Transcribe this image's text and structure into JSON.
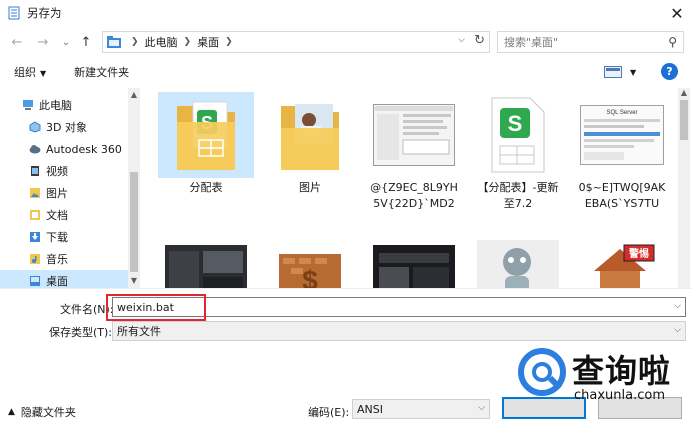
{
  "window": {
    "title": "另存为",
    "close_glyph": "✕"
  },
  "nav": {
    "back_glyph": "←",
    "forward_glyph": "→",
    "history_glyph": "⌄",
    "up_glyph": "↑",
    "breadcrumb": [
      "此电脑",
      "桌面"
    ],
    "search_placeholder": "搜索\"桌面\""
  },
  "toolbar": {
    "organize": "组织",
    "new_folder": "新建文件夹",
    "help": "?"
  },
  "sidebar": {
    "items": [
      {
        "label": "此电脑",
        "icon": "computer-icon"
      },
      {
        "label": "3D 对象",
        "icon": "3d-objects-icon"
      },
      {
        "label": "Autodesk 360",
        "icon": "cloud-icon"
      },
      {
        "label": "视频",
        "icon": "video-icon"
      },
      {
        "label": "图片",
        "icon": "pictures-icon"
      },
      {
        "label": "文档",
        "icon": "documents-icon"
      },
      {
        "label": "下载",
        "icon": "download-icon"
      },
      {
        "label": "音乐",
        "icon": "music-icon"
      },
      {
        "label": "桌面",
        "icon": "desktop-icon",
        "selected": true
      }
    ]
  },
  "files": [
    {
      "name": "分配表",
      "kind": "folder-spreadsheet"
    },
    {
      "name": "图片",
      "kind": "folder-photo"
    },
    {
      "name": "@{Z9EC_8L9YH\n5V{22D}`MD2",
      "kind": "screenshot"
    },
    {
      "name": "【分配表】-更新\n至7.2",
      "kind": "spreadsheet"
    },
    {
      "name": "0$~E]TWQ[9AK\nEBA(S`YS7TU",
      "kind": "sql-screenshot"
    },
    {
      "name": "",
      "kind": "dark-image"
    },
    {
      "name": "",
      "kind": "brick-dollar-image"
    },
    {
      "name": "",
      "kind": "dark-image"
    },
    {
      "name": "",
      "kind": "cartoon-image"
    },
    {
      "name": "",
      "kind": "warning-house-image"
    }
  ],
  "thumb_texts": {
    "sql_title": "SQL Server",
    "warning_sign": "警惕"
  },
  "form": {
    "filename_label": "文件名(N):",
    "filename_value": "weixin.bat",
    "filetype_label": "保存类型(T):",
    "filetype_value": "所有文件",
    "encoding_label": "编码(E):",
    "encoding_value": "ANSI"
  },
  "footer": {
    "hide_folders": "隐藏文件夹"
  },
  "watermark": {
    "brand": "查询啦",
    "url": "chaxunla.com"
  },
  "colors": {
    "selection": "#cce8ff",
    "highlight_box": "#e0282e",
    "accent": "#1d6fd6",
    "folder": "#f3c74f",
    "spreadsheet_green": "#2fa84f"
  }
}
